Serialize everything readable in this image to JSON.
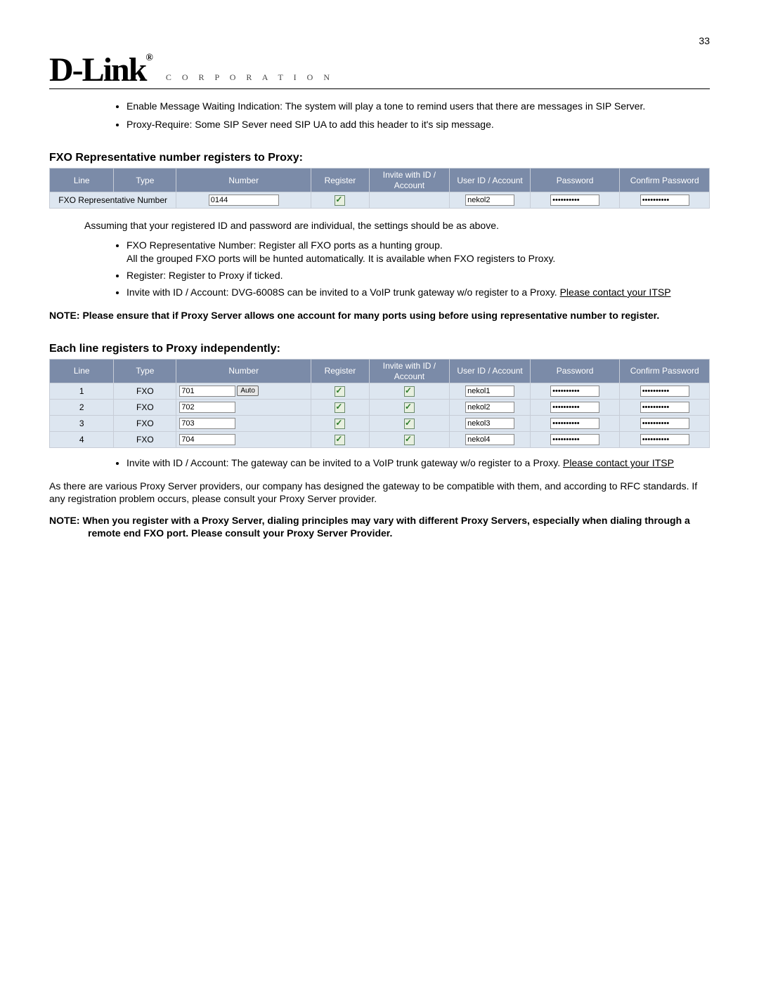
{
  "page_number": "33",
  "logo": {
    "brand": "D-Link",
    "reg": "®",
    "sub": "C O R P O R A T I O N"
  },
  "intro_bullets": [
    "Enable Message Waiting Indication: The system will play a tone to remind users that there are messages in SIP Server.",
    "Proxy-Require: Some SIP Sever need SIP UA to add this header to it's sip message."
  ],
  "section1": {
    "title": "FXO Representative number registers to Proxy:",
    "headers": {
      "line": "Line",
      "type": "Type",
      "number": "Number",
      "register": "Register",
      "invite": "Invite with ID / Account",
      "userid": "User ID / Account",
      "password": "Password",
      "confirm": "Confirm Password"
    },
    "row": {
      "label": "FXO Representative Number",
      "number": "0144",
      "userid": "nekol2",
      "password": "••••••••••",
      "confirm": "••••••••••"
    },
    "after_text": "Assuming that your registered ID and password are individual, the settings should be as above.",
    "bullets": [
      {
        "main": "FXO Representative Number: Register all FXO ports as a hunting group.",
        "sub": "All the grouped FXO ports will be hunted automatically. It is available when FXO registers to Proxy."
      },
      {
        "main": "Register: Register to Proxy if ticked."
      },
      {
        "main": "Invite with ID / Account: DVG-6008S can be invited to a VoIP trunk gateway w/o register to a Proxy. ",
        "link": "Please contact your ITSP"
      }
    ],
    "note": "NOTE: Please ensure that if Proxy Server allows one account for many ports using before using representative number to register."
  },
  "section2": {
    "title": "Each line registers to Proxy independently:",
    "headers": {
      "line": "Line",
      "type": "Type",
      "number": "Number",
      "register": "Register",
      "invite": "Invite with ID / Account",
      "userid": "User ID / Account",
      "password": "Password",
      "confirm": "Confirm Password"
    },
    "auto_label": "Auto",
    "rows": [
      {
        "line": "1",
        "type": "FXO",
        "number": "701",
        "userid": "nekol1",
        "password": "••••••••••",
        "confirm": "••••••••••",
        "auto": true
      },
      {
        "line": "2",
        "type": "FXO",
        "number": "702",
        "userid": "nekol2",
        "password": "••••••••••",
        "confirm": "••••••••••"
      },
      {
        "line": "3",
        "type": "FXO",
        "number": "703",
        "userid": "nekol3",
        "password": "••••••••••",
        "confirm": "••••••••••"
      },
      {
        "line": "4",
        "type": "FXO",
        "number": "704",
        "userid": "nekol4",
        "password": "••••••••••",
        "confirm": "••••••••••"
      }
    ],
    "bullets": [
      {
        "main": "Invite with ID / Account: The gateway can be invited to a VoIP trunk gateway w/o register to a Proxy. ",
        "link": "Please contact your ITSP"
      }
    ],
    "closing": "As there are various Proxy Server providers, our company has designed the gateway to be compatible with them, and according to RFC standards. If any registration problem occurs, please consult your Proxy Server provider.",
    "note": "NOTE: When you register with a Proxy Server, dialing principles may vary with different Proxy Servers, especially when dialing through a remote end FXO port. Please consult your Proxy Server Provider."
  }
}
